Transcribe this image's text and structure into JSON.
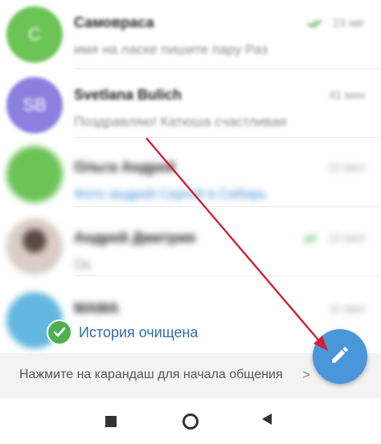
{
  "chats": [
    {
      "avatar_initial": "С",
      "avatar_color": "#6cc356",
      "name": "Самовраса",
      "time": "23 авг",
      "preview": "имя на ласке пишите пару Раз",
      "read_check": true,
      "blur": "soft"
    },
    {
      "avatar_initial": "SB",
      "avatar_color": "#8c7fe0",
      "name": "Svetlana Bulich",
      "time": "41 мин",
      "preview": "Поздравляю! Катюша счастливая",
      "read_check": false,
      "blur": "soft"
    },
    {
      "avatar_initial": "",
      "avatar_color": "#6cc356",
      "name": "Ольга Андрей",
      "time": "12 июл",
      "preview": "Фото андрей Сергей в Сибирь",
      "read_check": false,
      "blur": "hard"
    },
    {
      "avatar_initial": "",
      "avatar_color": "#c9b8ad",
      "name": "Андрей Дмитрия",
      "time": "12 июл",
      "preview": "Ок",
      "read_check": true,
      "blur": "hard"
    },
    {
      "avatar_initial": "",
      "avatar_color": "#62b8e0",
      "name": "МАМА",
      "time": "11 июл",
      "preview": "",
      "read_check": false,
      "blur": "hard"
    }
  ],
  "toast": {
    "text": "История очищена"
  },
  "hint": {
    "text": "Нажмите на карандаш для начала общения",
    "chevron": ">"
  },
  "fab": {
    "icon": "pencil-icon",
    "color": "#4a96db"
  },
  "nav": {
    "square": "recent-apps-icon",
    "circle": "home-icon",
    "triangle": "back-icon"
  },
  "colors": {
    "accent": "#4a96db",
    "check": "#4cb050",
    "annotation_arrow": "#cc2233"
  }
}
